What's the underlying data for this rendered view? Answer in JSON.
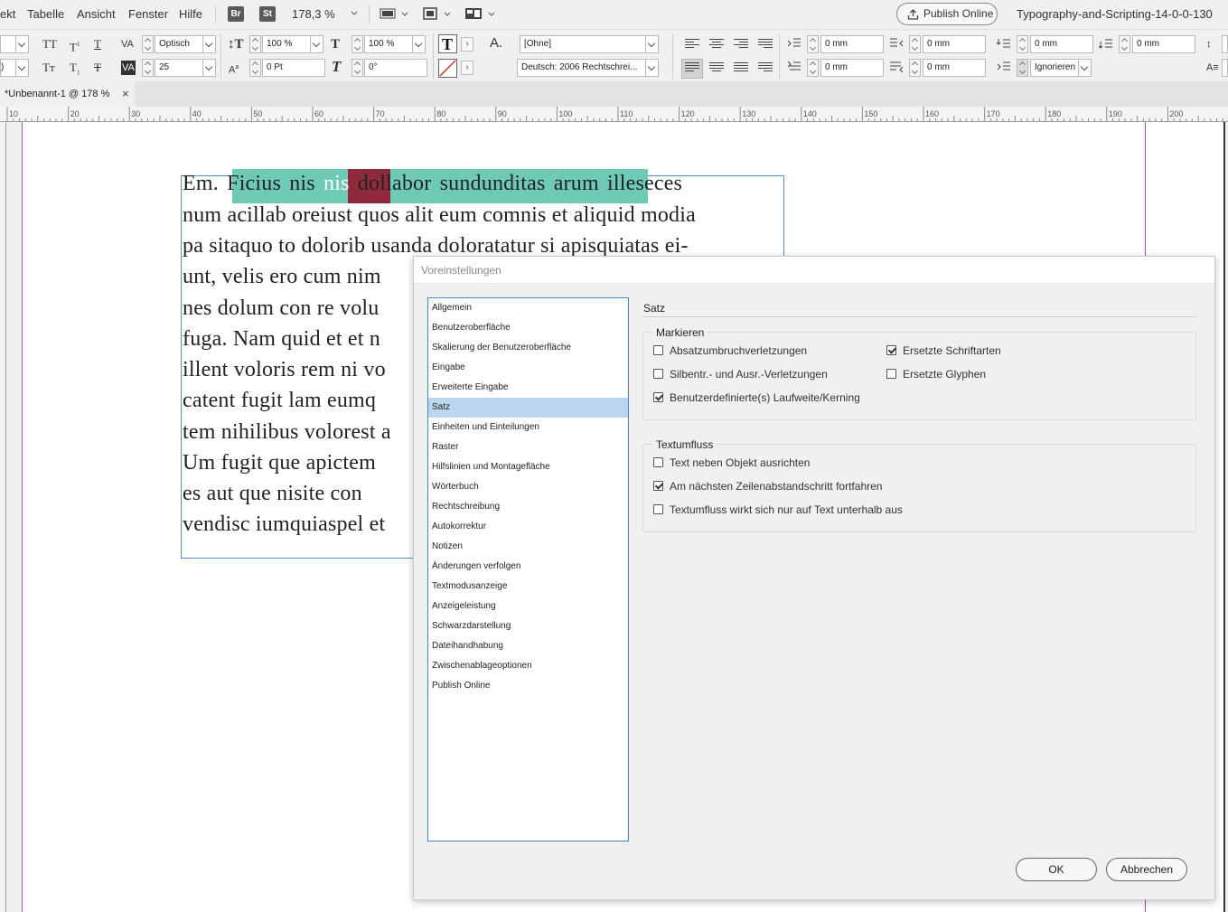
{
  "menu": {
    "items": [
      "ekt",
      "Tabelle",
      "Ansicht",
      "Fenster",
      "Hilfe"
    ],
    "br_badge": "Br",
    "st_badge": "St",
    "zoom": "178,3 %",
    "publish_label": "Publish Online",
    "doc_name": "Typography-and-Scripting-14-0-0-130"
  },
  "control": {
    "kerning": "Optisch",
    "tracking": "25",
    "vscale": "100 %",
    "hscale": "100 %",
    "baseline": "0 Pt",
    "skew": "0°",
    "char_style": "[Ohne]",
    "language": "Deutsch: 2006 Rechtschrei...",
    "indent_left": "0 mm",
    "indent_right": "0 mm",
    "first_line": "0 mm",
    "last_line": "0 mm",
    "space_before": "0 mm",
    "space_after": "0 mm",
    "dropcap_lines": "0 mm",
    "grid_align": "Ignorieren"
  },
  "tab": {
    "title": "*Unbenannt-1 @ 178 %",
    "close": "×"
  },
  "ruler": {
    "ticks": [
      "10",
      "20",
      "30",
      "40",
      "50",
      "60",
      "70",
      "80",
      "90",
      "100",
      "110",
      "120",
      "130",
      "140",
      "150",
      "160",
      "170",
      "180",
      "190",
      "200"
    ]
  },
  "document": {
    "line1_pre": "Em. ",
    "line1_hl1": "Ficius nis ",
    "line1_sel": "nis",
    "line1_hl2": " dollabor sundunditas a",
    "line1_post": "rum illeseces",
    "lines": [
      "num acillab oreiust quos alit eum comnis et aliquid modia",
      "pa sitaquo to dolorib usanda doloratatur si apisquiatas ei-",
      "unt, velis ero cum nim",
      "nes dolum con re volu",
      "fuga. Nam quid et et n",
      "illent voloris rem ni vo",
      "catent fugit lam eumq",
      "tem nihilibus volorest a",
      "Um fugit que apictem",
      "es aut que nisite con",
      "vendisc iumquiaspel et"
    ]
  },
  "dialog": {
    "title": "Voreinstellungen",
    "categories": [
      "Allgemein",
      "Benutzeroberfläche",
      "Skalierung der Benutzeroberfläche",
      "Eingabe",
      "Erweiterte Eingabe",
      "Satz",
      "Einheiten und Einteilungen",
      "Raster",
      "Hilfslinien und Montagefläche",
      "Wörterbuch",
      "Rechtschreibung",
      "Autokorrektur",
      "Notizen",
      "Änderungen verfolgen",
      "Textmodusanzeige",
      "Anzeigeleistung",
      "Schwarzdarstellung",
      "Dateihandhabung",
      "Zwischenablageoptionen",
      "Publish Online"
    ],
    "selected_category": "Satz",
    "section_title": "Satz",
    "markieren": {
      "title": "Markieren",
      "options": [
        {
          "label": "Absatzumbruchverletzungen",
          "checked": false
        },
        {
          "label": "Silbentr.- und Ausr.-Verletzungen",
          "checked": false
        },
        {
          "label": "Benutzerdefinierte(s) Laufweite/Kerning",
          "checked": true
        },
        {
          "label": "Ersetzte Schriftarten",
          "checked": true
        },
        {
          "label": "Ersetzte Glyphen",
          "checked": false
        }
      ]
    },
    "textfluss": {
      "title": "Textumfluss",
      "options": [
        {
          "label": "Text neben Objekt ausrichten",
          "checked": false
        },
        {
          "label": "Am nächsten Zeilenabstandschritt fortfahren",
          "checked": true
        },
        {
          "label": "Textumfluss wirkt sich nur auf Text unterhalb aus",
          "checked": false
        }
      ]
    },
    "ok_label": "OK",
    "cancel_label": "Abbrechen"
  },
  "colors": {
    "highlight": "#6ec9b6",
    "selection": "#8e2a3b",
    "frame": "#4d8fd0",
    "margin_guide": "#b14bb1"
  }
}
